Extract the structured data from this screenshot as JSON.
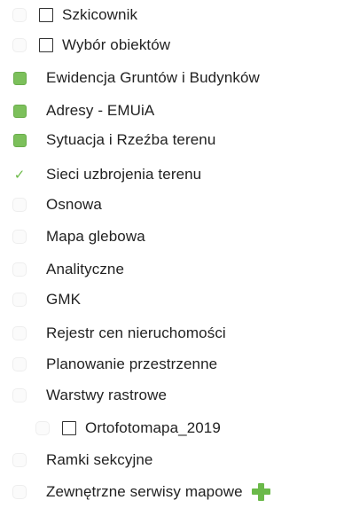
{
  "layers": [
    {
      "label": "Szkicownik",
      "state": "empty",
      "checkbox": true,
      "indent": 0
    },
    {
      "label": "Wybór obiektów",
      "state": "empty",
      "checkbox": true,
      "indent": 0
    },
    {
      "label": "Ewidencja Gruntów i Budynków",
      "state": "full",
      "checkbox": false,
      "indent": 0
    },
    {
      "label": "Adresy - EMUiA",
      "state": "full",
      "checkbox": false,
      "indent": 0
    },
    {
      "label": "Sytuacja i Rzeźba terenu",
      "state": "full",
      "checkbox": false,
      "indent": 0
    },
    {
      "label": "Sieci uzbrojenia terenu",
      "state": "partial",
      "checkbox": false,
      "indent": 0
    },
    {
      "label": "Osnowa",
      "state": "empty",
      "checkbox": false,
      "indent": 0
    },
    {
      "label": "Mapa glebowa",
      "state": "empty",
      "checkbox": false,
      "indent": 0
    },
    {
      "label": "Analityczne",
      "state": "empty",
      "checkbox": false,
      "indent": 0
    },
    {
      "label": "GMK",
      "state": "empty",
      "checkbox": false,
      "indent": 0
    },
    {
      "label": "Rejestr cen nieruchomości",
      "state": "empty",
      "checkbox": false,
      "indent": 0
    },
    {
      "label": "Planowanie przestrzenne",
      "state": "empty",
      "checkbox": false,
      "indent": 0
    },
    {
      "label": "Warstwy rastrowe",
      "state": "empty",
      "checkbox": false,
      "indent": 0
    },
    {
      "label": "Ortofotomapa_2019",
      "state": "empty",
      "checkbox": true,
      "indent": 1
    },
    {
      "label": "Ramki sekcyjne",
      "state": "empty",
      "checkbox": false,
      "indent": 0
    },
    {
      "label": "Zewnętrzne serwisy mapowe",
      "state": "empty",
      "checkbox": false,
      "indent": 0,
      "action": "plus-icon"
    }
  ],
  "colors": {
    "active": "#7cc05b",
    "tick": "#6dbb4a",
    "plus": "#6bb94a"
  }
}
